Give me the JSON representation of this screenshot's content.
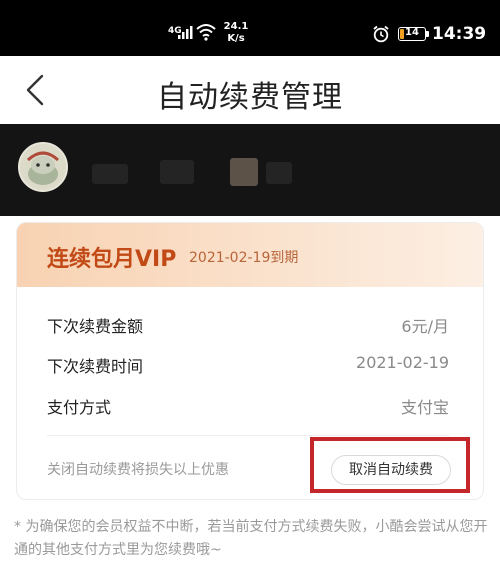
{
  "status_bar": {
    "network": "4G",
    "speed_value": "24.1",
    "speed_unit": "K/s",
    "battery_level": "14",
    "battery_fraction": 0.14,
    "time": "14:39",
    "battery_color": "#f0a020"
  },
  "nav": {
    "back_icon": "chevron-left-icon",
    "title": "自动续费管理"
  },
  "user": {
    "avatar": "user-avatar"
  },
  "subscription": {
    "plan_name": "连续包月VIP",
    "expire_text": "2021-02-19到期",
    "rows": [
      {
        "label": "下次续费金额",
        "value": "6元/月"
      },
      {
        "label": "下次续费时间",
        "value": "2021-02-19"
      },
      {
        "label": "支付方式",
        "value": "支付宝"
      }
    ],
    "warning": "关闭自动续费将损失以上优惠",
    "cancel_label": "取消自动续费",
    "accent_color": "#c24a17"
  },
  "footnote": "* 为确保您的会员权益不中断，若当前支付方式续费失败，小酷会尝试从您开通的其他支付方式里为您续费哦~"
}
